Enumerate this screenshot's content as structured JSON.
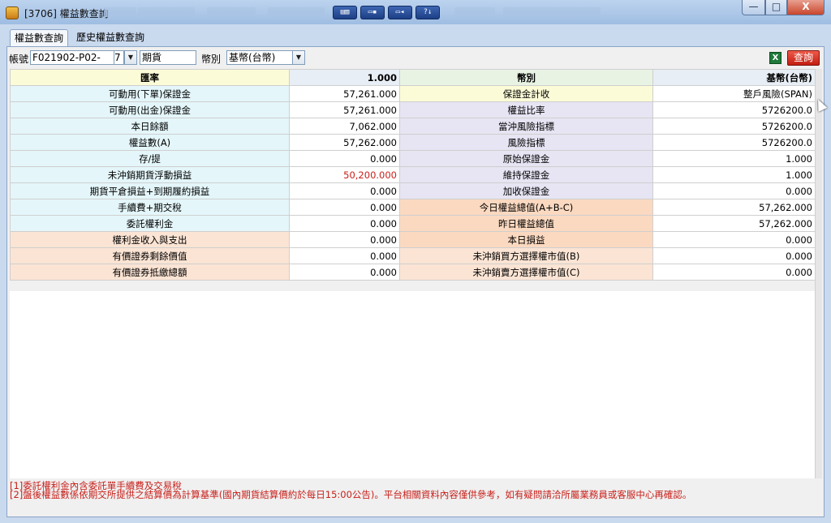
{
  "window": {
    "title": "[3706] 權益數查詢",
    "toolbar_icons": [
      "layout-icon",
      "monitor-icon",
      "video-icon",
      "help-icon"
    ],
    "controls": {
      "minimize": "—",
      "maximize": "□",
      "close": "X"
    }
  },
  "tabs": [
    {
      "label": "權益數查詢",
      "active": true
    },
    {
      "label": "歷史權益數查詢",
      "active": false
    }
  ],
  "filters": {
    "account_label": "帳號",
    "account_value": "F021902-P02-",
    "account_suffix": "7",
    "market_value": "期貨",
    "currency_label": "幣別",
    "currency_value": "基幣(台幣)",
    "excel_icon": "excel-icon",
    "query_label": "查詢"
  },
  "table": {
    "header": {
      "left_label": "匯率",
      "left_value": "1.000",
      "right_label": "幣別",
      "right_value": "基幣(台幣)"
    },
    "rows": [
      {
        "l_label": "可動用(下單)保證金",
        "l_value": "57,261.000",
        "r_label": "保證金計收",
        "r_value": "整戶風險(SPAN)"
      },
      {
        "l_label": "可動用(出金)保證金",
        "l_value": "57,261.000",
        "r_label": "權益比率",
        "r_value": "5726200.0"
      },
      {
        "l_label": "本日餘額",
        "l_value": "7,062.000",
        "r_label": "當沖風險指標",
        "r_value": "5726200.0"
      },
      {
        "l_label": "權益數(A)",
        "l_value": "57,262.000",
        "r_label": "風險指標",
        "r_value": "5726200.0"
      },
      {
        "l_label": "存/提",
        "l_value": "0.000",
        "r_label": "原始保證金",
        "r_value": "1.000"
      },
      {
        "l_label": "未沖銷期貨浮動損益",
        "l_value": "50,200.000",
        "r_label": "維持保證金",
        "r_value": "1.000"
      },
      {
        "l_label": "期貨平倉損益+到期履約損益",
        "l_value": "0.000",
        "r_label": "加收保證金",
        "r_value": "0.000"
      },
      {
        "l_label": "手續費+期交稅",
        "l_value": "0.000",
        "r_label": "今日權益總值(A+B-C)",
        "r_value": "57,262.000"
      },
      {
        "l_label": "委託權利金",
        "l_value": "0.000",
        "r_label": "昨日權益總值",
        "r_value": "57,262.000"
      },
      {
        "l_label": "權利金收入與支出",
        "l_value": "0.000",
        "r_label": "本日損益",
        "r_value": "0.000"
      },
      {
        "l_label": "有價證券剩餘價值",
        "l_value": "0.000",
        "r_label": "未沖銷買方選擇權市值(B)",
        "r_value": "0.000"
      },
      {
        "l_label": "有價證券抵繳總額",
        "l_value": "0.000",
        "r_label": "未沖銷賣方選擇權市值(C)",
        "r_value": "0.000"
      }
    ]
  },
  "notes": [
    "[1]委託權利金內含委託單手續費及交易稅",
    "[2]盤後權益數係依期交所提供之結算價為計算基準(國內期貨結算價約於每日15:00公告)。平台相關資料內容僅供參考，如有疑問請洽所屬業務員或客服中心再確認。"
  ],
  "colors": {
    "negative_value": "#c8201a",
    "query_button": "#d8291a"
  }
}
